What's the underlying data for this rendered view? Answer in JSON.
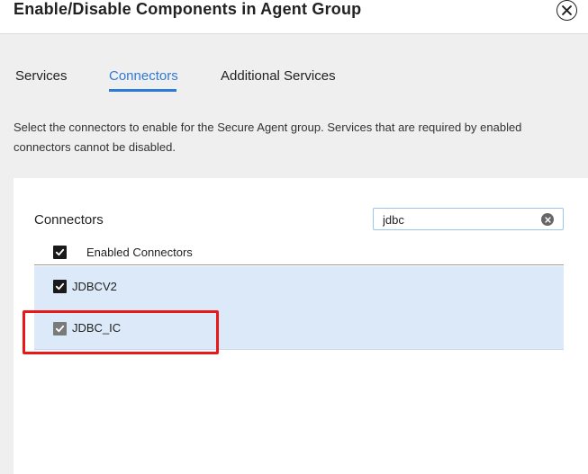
{
  "dialog": {
    "title": "Enable/Disable Components in Agent Group"
  },
  "tabs": [
    {
      "label": "Services",
      "active": false
    },
    {
      "label": "Connectors",
      "active": true
    },
    {
      "label": "Additional Services",
      "active": false
    }
  ],
  "description": "Select the connectors to enable for the Secure Agent group. Services that are required by enabled connectors cannot be disabled.",
  "connectors": {
    "label": "Connectors",
    "search": {
      "value": "jdbc"
    },
    "header": {
      "label": "Enabled Connectors",
      "checked": true
    },
    "rows": [
      {
        "label": "JDBCV2",
        "checked": true,
        "disabled": false
      },
      {
        "label": "JDBC_IC",
        "checked": true,
        "disabled": true
      }
    ]
  },
  "colors": {
    "accent": "#2e7bd6",
    "row_selected": "#dbe9f8",
    "highlight": "#e81818"
  }
}
